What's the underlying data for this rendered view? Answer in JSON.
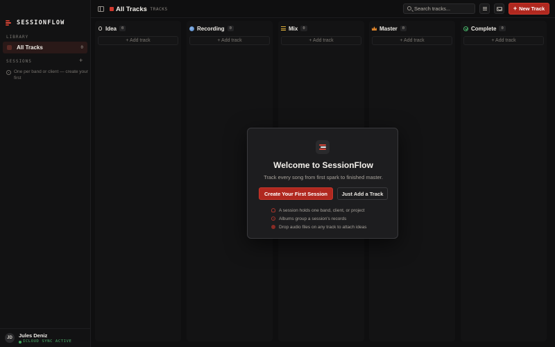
{
  "sidebar": {
    "brand": "SESSIONFLOW",
    "library_label": "LIBRARY",
    "nav": [
      {
        "label": "All Tracks",
        "count": "0"
      }
    ],
    "sessions_label": "SESSIONS",
    "add_session": "+",
    "sessions_hint": "One per band or client — create your first",
    "user": {
      "initials": "JD",
      "name": "Jules Deniz",
      "sync": "ICLOUD SYNC ACTIVE"
    }
  },
  "header": {
    "title": "All Tracks",
    "count_text": "0 TRACKS",
    "search_placeholder": "Search tracks...",
    "new_track": "New Track",
    "new_track_plus": "+"
  },
  "columns": [
    {
      "title": "Idea",
      "count": "0",
      "icon": "lightbulb-icon",
      "add": "+ Add track"
    },
    {
      "title": "Recording",
      "count": "0",
      "icon": "recording-icon",
      "add": "+ Add track"
    },
    {
      "title": "Mix",
      "count": "0",
      "icon": "mixer-icon",
      "add": "+ Add track"
    },
    {
      "title": "Master",
      "count": "0",
      "icon": "crown-icon",
      "add": "+ Add track"
    },
    {
      "title": "Complete",
      "count": "0",
      "icon": "check-circle-icon",
      "add": "+ Add track"
    }
  ],
  "modal": {
    "title": "Welcome to SessionFlow",
    "subtitle": "Track every song from first spark to finished master.",
    "primary": "Create Your First Session",
    "secondary": "Just Add a Track",
    "tips": [
      "A session holds one band, client, or project",
      "Albums group a session's records",
      "Drop audio files on any track to attach ideas"
    ]
  },
  "colors": {
    "accent": "#b0281f",
    "background": "#0f0f10",
    "sync": "#4caf6a"
  }
}
